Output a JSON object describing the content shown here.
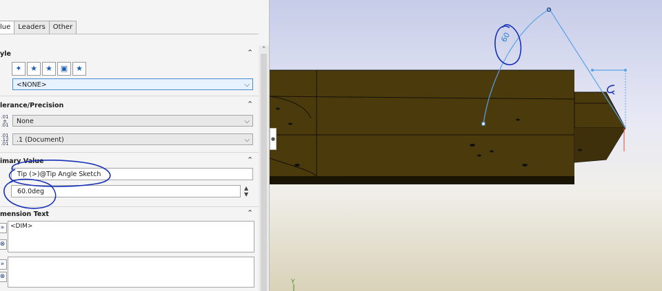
{
  "tabs": [
    {
      "label": "lue",
      "active": true
    },
    {
      "label": "Leaders",
      "active": false
    },
    {
      "label": "Other",
      "active": false
    }
  ],
  "sections": {
    "style": {
      "title": "yle",
      "icons": [
        "dimension-style-icon",
        "add-favorite-icon",
        "remove-favorite-icon",
        "save-favorite-icon",
        "load-favorite-icon"
      ],
      "dropdown_value": "<NONE>"
    },
    "tolerance": {
      "title": "lerance/Precision",
      "tolerance_type": "None",
      "precision": ".1 (Document)"
    },
    "primary_value": {
      "title": "imary Value",
      "dimension_name": "Tip (>)@Tip Angle Sketch",
      "dimension_value": "60.0deg"
    },
    "dimension_text": {
      "title": "mension Text",
      "text_above": "<DIM>",
      "text_below": ""
    }
  },
  "viewport": {
    "angle_annotation": "60",
    "axis_label": "Y"
  },
  "colors": {
    "model_body": "#4a3a0c",
    "sketch_line": "#2b7fd6",
    "markup_ink": "#1430b8"
  }
}
